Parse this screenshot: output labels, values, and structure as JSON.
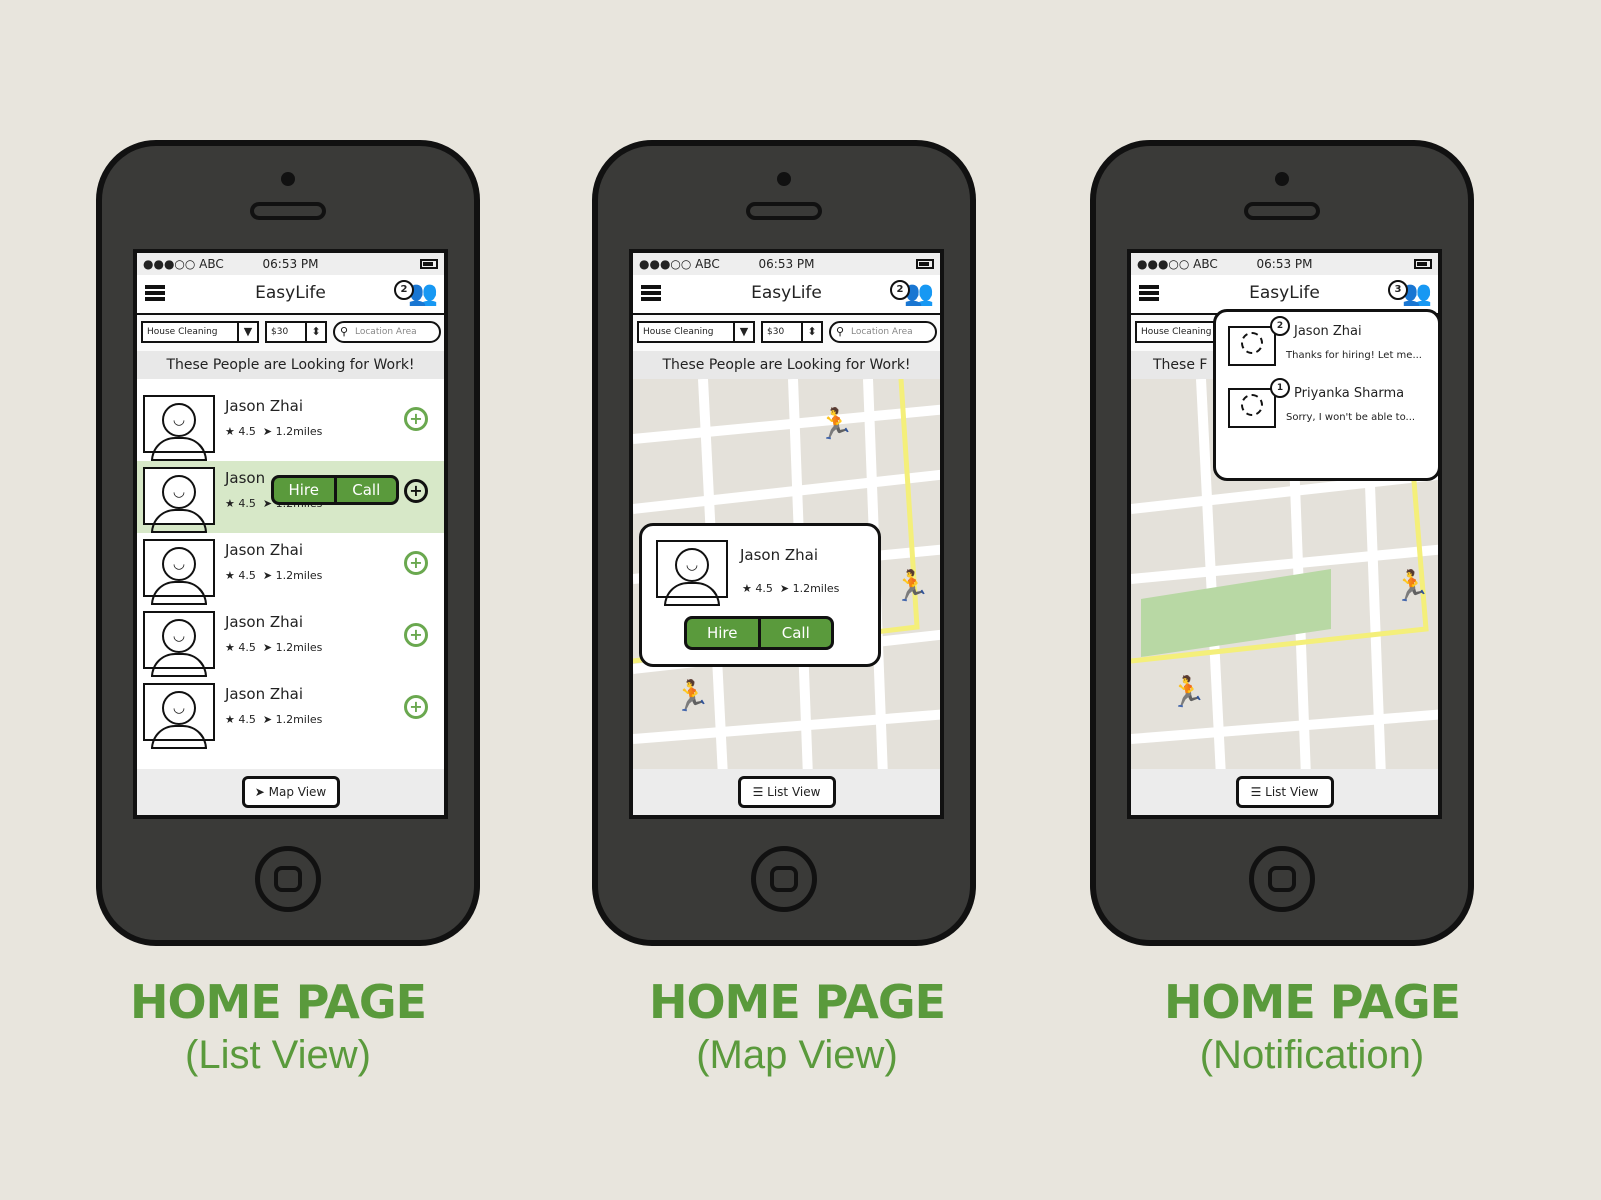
{
  "status": {
    "carrier": "●●●○○ ABC",
    "time": "06:53 PM"
  },
  "app": {
    "title": "EasyLife",
    "badge_list": "2",
    "badge_map": "2",
    "badge_notif": "3"
  },
  "filters": {
    "category": "House Cleaning",
    "category_short": "House Cleaning",
    "price": "$30",
    "location_placeholder": "Location Area"
  },
  "headline": "These People are Looking for Work!",
  "workers": [
    {
      "name": "Jason Zhai",
      "rating": "4.5",
      "distance": "1.2miles"
    },
    {
      "name": "Jason",
      "rating": "4.5",
      "distance": "1.2miles"
    },
    {
      "name": "Jason Zhai",
      "rating": "4.5",
      "distance": "1.2miles"
    },
    {
      "name": "Jason Zhai",
      "rating": "4.5",
      "distance": "1.2miles"
    },
    {
      "name": "Jason Zhai",
      "rating": "4.5",
      "distance": "1.2miles"
    }
  ],
  "actions": {
    "hire": "Hire",
    "call": "Call"
  },
  "map_popup": {
    "name": "Jason Zhai",
    "rating": "4.5",
    "distance": "1.2miles"
  },
  "buttons": {
    "map_view": "Map View",
    "list_view": "List View"
  },
  "notifications": [
    {
      "badge": "2",
      "name": "Jason Zhai",
      "message": "Thanks for hiring! Let me..."
    },
    {
      "badge": "1",
      "name": "Priyanka Sharma",
      "message": "Sorry, I won't be able to..."
    }
  ],
  "captions": [
    {
      "title": "HOME PAGE",
      "subtitle": "(List View)"
    },
    {
      "title": "HOME PAGE",
      "subtitle": "(Map View)"
    },
    {
      "title": "HOME PAGE",
      "subtitle": "(Notification)"
    }
  ],
  "colors": {
    "accent": "#5a9a3c",
    "selected_row": "#d7e8c8",
    "road_highlight": "#f4ef7a",
    "park": "#b8d8a4"
  }
}
